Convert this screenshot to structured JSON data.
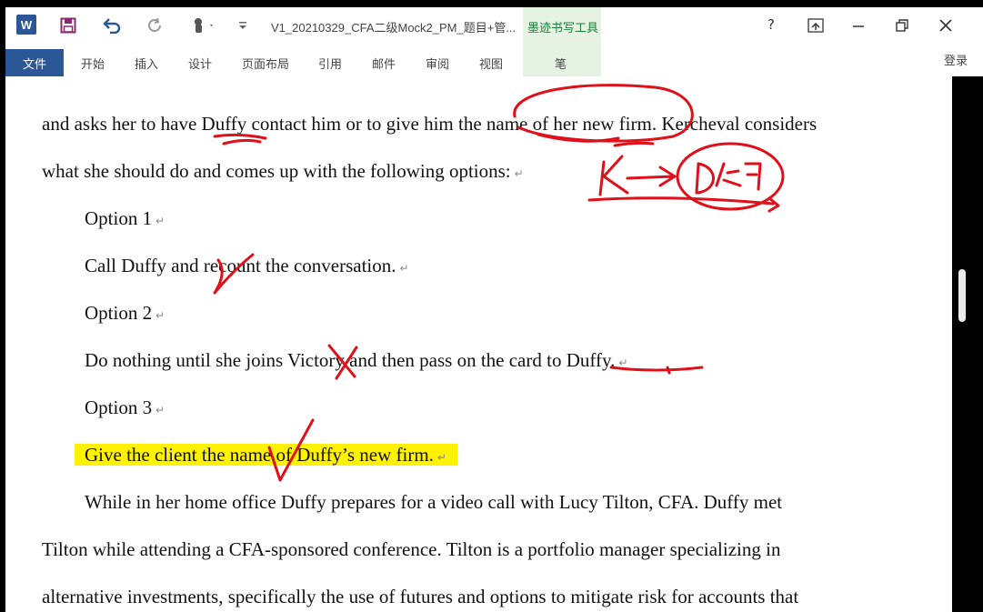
{
  "titlebar": {
    "app_logo": "W",
    "document_title": "V1_20210329_CFA二级Mock2_PM_题目+管...",
    "ink_tools_title": "墨迹书写工具",
    "help": "?",
    "icons": [
      "save-icon",
      "undo-icon",
      "redo-icon",
      "touch-mode-icon",
      "customize-qat-icon",
      "ribbon-display-icon",
      "minimize-icon",
      "restore-icon",
      "close-icon"
    ]
  },
  "ribbon": {
    "file": "文件",
    "tabs": [
      "开始",
      "插入",
      "设计",
      "页面布局",
      "引用",
      "邮件",
      "审阅",
      "视图"
    ],
    "ink_tab": "笔",
    "login": "登录"
  },
  "document": {
    "lines": [
      "and asks her to have Duffy contact him or to give him the name of her new firm. Kercheval considers",
      "what she should do and comes up with the following options:",
      "Option 1",
      "Call Duffy and recount the conversation.",
      "Option 2",
      "Do nothing until she joins Victory and then pass on the card to Duffy.",
      "Option 3",
      "Give the client the name of Duffy’s new firm.",
      "While in her home office Duffy prepares for a video call with Lucy Tilton, CFA. Duffy met",
      "Tilton while attending a CFA-sponsored conference. Tilton is a portfolio manager specializing in",
      "alternative investments, specifically the use of futures and options to mitigate risk for accounts that"
    ],
    "paragraph_mark": "↵"
  },
  "annotations": {
    "ink_color": "#e0101a",
    "handwritten_note": "K → D公司"
  },
  "colors": {
    "file_tab": "#2b5797",
    "highlight": "#fff200",
    "ink_tab_bg": "#e6f3e3"
  }
}
